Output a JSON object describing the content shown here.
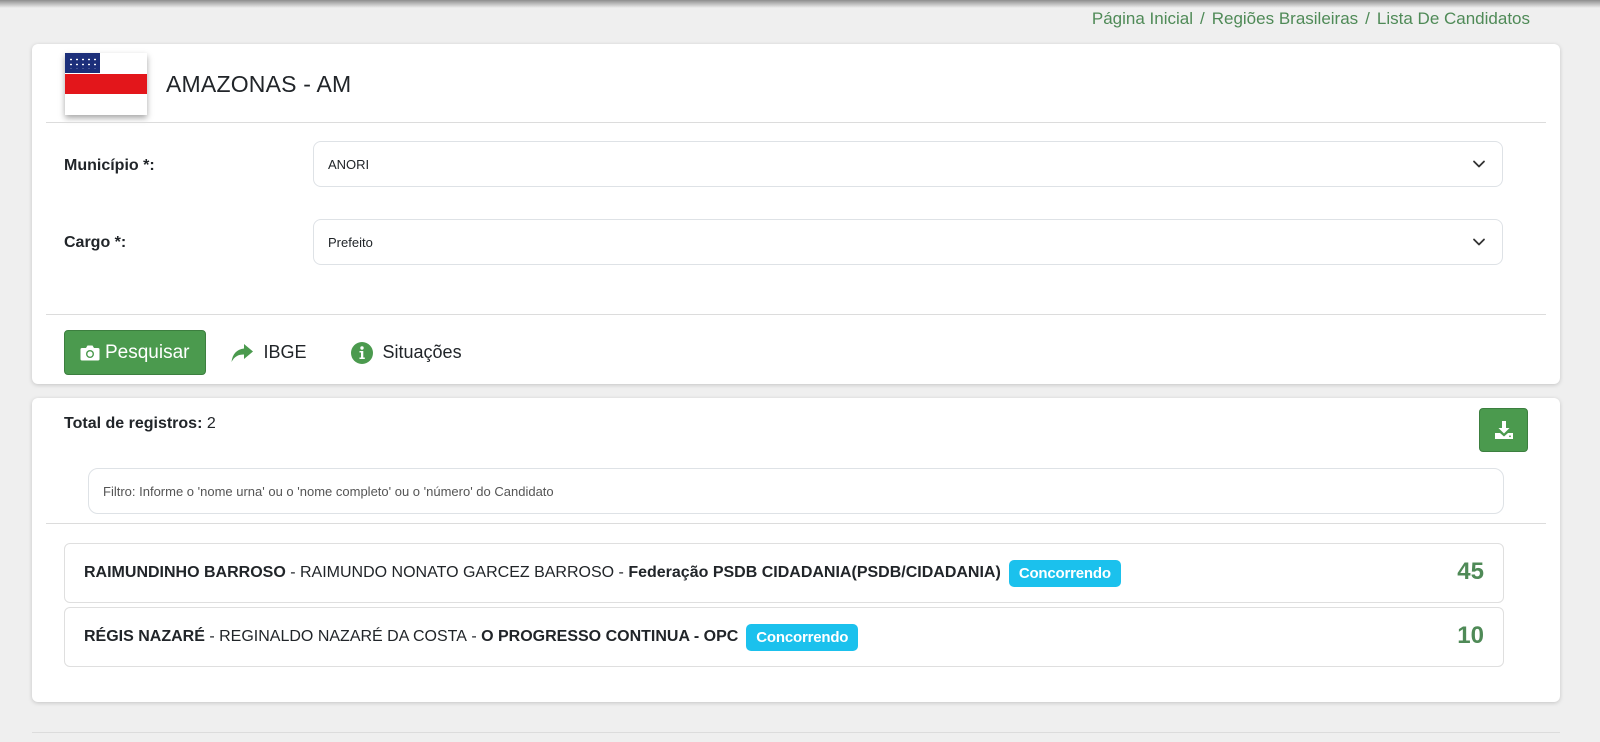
{
  "breadcrumb": [
    "Página Inicial",
    "Regiões Brasileiras",
    "Lista De Candidatos"
  ],
  "breadcrumb_separator": "/",
  "state": {
    "title": "AMAZONAS - AM",
    "flag_icon": "amazonas-flag"
  },
  "form": {
    "municipio": {
      "label": "Município *:",
      "value": "ANORI"
    },
    "cargo": {
      "label": "Cargo *:",
      "value": "Prefeito"
    }
  },
  "actions": {
    "search_label": "Pesquisar",
    "ibge_label": "IBGE",
    "situacoes_label": "Situações"
  },
  "results": {
    "total_label": "Total de registros:",
    "total_value": "2",
    "filter_placeholder": "Filtro: Informe o 'nome urna' ou o 'nome completo' ou o 'número' do Candidato",
    "candidates": [
      {
        "nome_urna": "RAIMUNDINHO BARROSO",
        "sep1": " - ",
        "nome_completo": "RAIMUNDO NONATO GARCEZ BARROSO",
        "sep2": " - ",
        "partido": "Federação PSDB CIDADANIA(PSDB/CIDADANIA)",
        "status": "Concorrendo",
        "numero": "45"
      },
      {
        "nome_urna": "RÉGIS NAZARÉ",
        "sep1": " - ",
        "nome_completo": "REGINALDO NAZARÉ DA COSTA",
        "sep2": " - ",
        "partido": "O PROGRESSO CONTINUA - OPC",
        "status": "Concorrendo",
        "numero": "10"
      }
    ]
  },
  "colors": {
    "accent_green": "#4b9a4e",
    "link_green": "#4f8a57",
    "badge_cyan": "#1bc1ed"
  }
}
